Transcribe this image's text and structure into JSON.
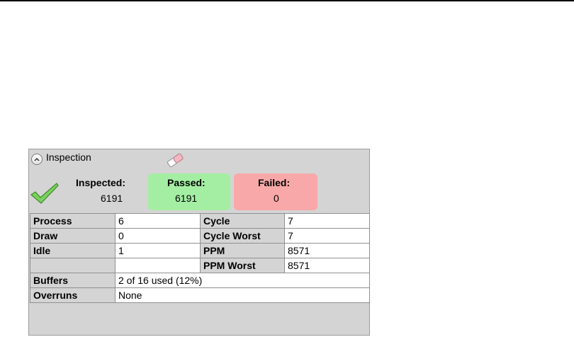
{
  "panel": {
    "title": "Inspection",
    "icons": {
      "collapse": "chevron-up-icon",
      "clear": "eraser-icon",
      "status": "checkmark-icon"
    }
  },
  "counters": {
    "inspected": {
      "label": "Inspected:",
      "value": "6191"
    },
    "passed": {
      "label": "Passed:",
      "value": "6191",
      "color": "#a4eea4"
    },
    "failed": {
      "label": "Failed:",
      "value": "0",
      "color": "#f8a8a8"
    }
  },
  "stats": {
    "process": {
      "label": "Process",
      "value": "6"
    },
    "cycle": {
      "label": "Cycle",
      "value": "7"
    },
    "draw": {
      "label": "Draw",
      "value": "0"
    },
    "cycle_worst": {
      "label": "Cycle Worst",
      "value": "7"
    },
    "idle": {
      "label": "Idle",
      "value": "1"
    },
    "ppm": {
      "label": "PPM",
      "value": "8571"
    },
    "ppm_worst": {
      "label": "PPM Worst",
      "value": "8571"
    },
    "buffers": {
      "label": "Buffers",
      "value": "2 of 16 used (12%)"
    },
    "overruns": {
      "label": "Overruns",
      "value": "None"
    }
  }
}
